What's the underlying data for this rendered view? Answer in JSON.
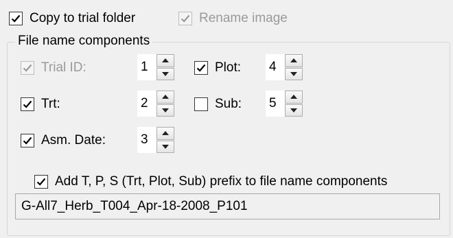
{
  "top": {
    "copy_to_trial": {
      "label": "Copy to trial folder",
      "checked": true,
      "enabled": true
    },
    "rename_image": {
      "label": "Rename image",
      "checked": true,
      "enabled": false
    }
  },
  "group": {
    "title": "File name components",
    "trial_id": {
      "label": "Trial ID:",
      "checked": true,
      "enabled": false,
      "value": "1"
    },
    "plot": {
      "label": "Plot:",
      "checked": true,
      "value": "4"
    },
    "trt": {
      "label": "Trt:",
      "checked": true,
      "value": "2"
    },
    "sub": {
      "label": "Sub:",
      "checked": false,
      "value": "5"
    },
    "asm_date": {
      "label": "Asm. Date:",
      "checked": true,
      "value": "3"
    },
    "prefix": {
      "label": "Add T, P, S (Trt, Plot, Sub) prefix to file name components",
      "checked": true
    },
    "preview": "G-All7_Herb_T004_Apr-18-2008_P101"
  },
  "icons": {
    "check": "check-icon",
    "spin_up": "spin-up-icon",
    "spin_down": "spin-down-icon"
  },
  "colors": {
    "background": "#f0f0f0",
    "disabled_text": "#9a9a9a",
    "border": "#d6d6d6"
  }
}
